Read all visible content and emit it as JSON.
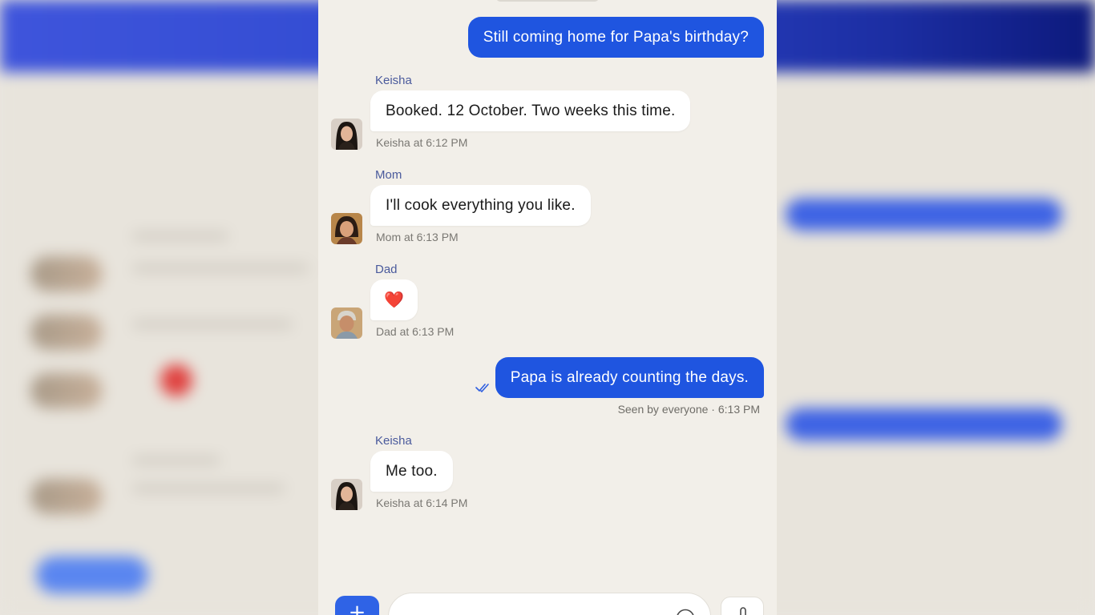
{
  "colors": {
    "accent": "#1f55e0",
    "outgoing_bubble": "#1f55e0",
    "incoming_bubble": "#ffffff",
    "sender_name": "#4a5a9c",
    "panel_background": "#f2efe9"
  },
  "chat": {
    "messages": [
      {
        "direction": "outgoing",
        "text": "Still coming home for Papa's birthday?"
      },
      {
        "direction": "incoming",
        "sender": "Keisha",
        "text": "Booked. 12 October. Two weeks this time.",
        "meta": "Keisha at 6:12 PM",
        "avatar": "keisha-avatar"
      },
      {
        "direction": "incoming",
        "sender": "Mom",
        "text": "I'll cook everything you like.",
        "meta": "Mom at 6:13 PM",
        "avatar": "mom-avatar"
      },
      {
        "direction": "incoming",
        "sender": "Dad",
        "text": "❤️",
        "meta": "Dad at 6:13 PM",
        "avatar": "dad-avatar"
      },
      {
        "direction": "outgoing",
        "text": "Papa is already counting the days.",
        "receipt": "Seen by everyone · 6:13 PM",
        "receipt_icon": "double-check-icon"
      },
      {
        "direction": "incoming",
        "sender": "Keisha",
        "text": "Me too.",
        "meta": "Keisha at 6:14 PM",
        "avatar": "keisha-avatar"
      }
    ]
  },
  "composer": {
    "plus_label": "+",
    "input_value": "",
    "emoji_icon": "emoji-icon",
    "mic_icon": "mic-icon"
  }
}
